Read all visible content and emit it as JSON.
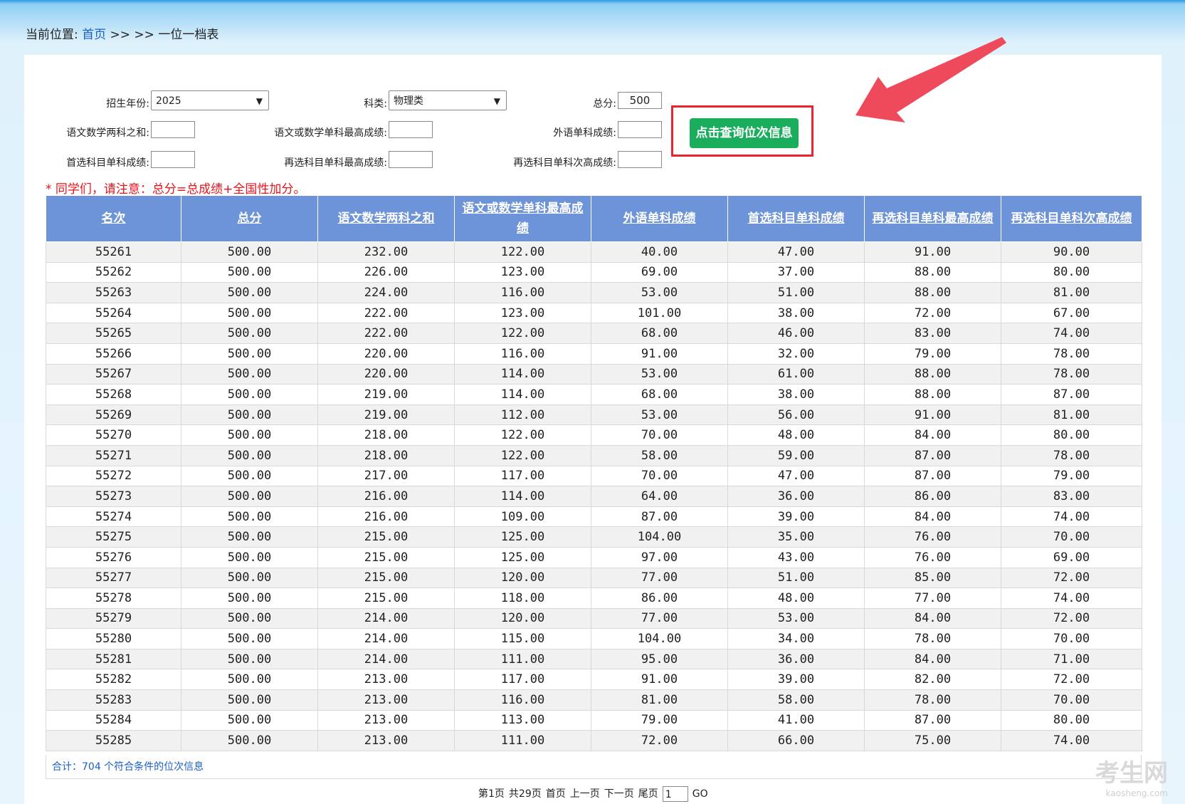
{
  "breadcrumb": {
    "label": "当前位置:",
    "home": "首页",
    "sep": " >> >> ",
    "current": "一位一档表"
  },
  "form": {
    "year_label": "招生年份:",
    "year_value": "2025",
    "type_label": "科类:",
    "type_value": "物理类",
    "total_label": "总分:",
    "total_value": "500",
    "cm_sum_label": "语文数学两科之和:",
    "cm_max_label": "语文或数学单科最高成绩:",
    "fl_label": "外语单科成绩:",
    "first_label": "首选科目单科成绩:",
    "re_max_label": "再选科目单科最高成绩:",
    "re_second_label": "再选科目单科次高成绩:",
    "query_button": "点击查询位次信息"
  },
  "notice": "* 同学们，请注意：总分=总成绩+全国性加分。",
  "table": {
    "headers": [
      "名次",
      "总分",
      "语文数学两科之和",
      "语文或数学单科最高成绩",
      "外语单科成绩",
      "首选科目单科成绩",
      "再选科目单科最高成绩",
      "再选科目单科次高成绩"
    ],
    "rows": [
      [
        "55261",
        "500.00",
        "232.00",
        "122.00",
        "40.00",
        "47.00",
        "91.00",
        "90.00"
      ],
      [
        "55262",
        "500.00",
        "226.00",
        "123.00",
        "69.00",
        "37.00",
        "88.00",
        "80.00"
      ],
      [
        "55263",
        "500.00",
        "224.00",
        "116.00",
        "53.00",
        "51.00",
        "88.00",
        "81.00"
      ],
      [
        "55264",
        "500.00",
        "222.00",
        "123.00",
        "101.00",
        "38.00",
        "72.00",
        "67.00"
      ],
      [
        "55265",
        "500.00",
        "222.00",
        "122.00",
        "68.00",
        "46.00",
        "83.00",
        "74.00"
      ],
      [
        "55266",
        "500.00",
        "220.00",
        "116.00",
        "91.00",
        "32.00",
        "79.00",
        "78.00"
      ],
      [
        "55267",
        "500.00",
        "220.00",
        "114.00",
        "53.00",
        "61.00",
        "88.00",
        "78.00"
      ],
      [
        "55268",
        "500.00",
        "219.00",
        "114.00",
        "68.00",
        "38.00",
        "88.00",
        "87.00"
      ],
      [
        "55269",
        "500.00",
        "219.00",
        "112.00",
        "53.00",
        "56.00",
        "91.00",
        "81.00"
      ],
      [
        "55270",
        "500.00",
        "218.00",
        "122.00",
        "70.00",
        "48.00",
        "84.00",
        "80.00"
      ],
      [
        "55271",
        "500.00",
        "218.00",
        "122.00",
        "58.00",
        "59.00",
        "87.00",
        "78.00"
      ],
      [
        "55272",
        "500.00",
        "217.00",
        "117.00",
        "70.00",
        "47.00",
        "87.00",
        "79.00"
      ],
      [
        "55273",
        "500.00",
        "216.00",
        "114.00",
        "64.00",
        "36.00",
        "86.00",
        "83.00"
      ],
      [
        "55274",
        "500.00",
        "216.00",
        "109.00",
        "87.00",
        "39.00",
        "84.00",
        "74.00"
      ],
      [
        "55275",
        "500.00",
        "215.00",
        "125.00",
        "104.00",
        "35.00",
        "76.00",
        "70.00"
      ],
      [
        "55276",
        "500.00",
        "215.00",
        "125.00",
        "97.00",
        "43.00",
        "76.00",
        "69.00"
      ],
      [
        "55277",
        "500.00",
        "215.00",
        "120.00",
        "77.00",
        "51.00",
        "85.00",
        "72.00"
      ],
      [
        "55278",
        "500.00",
        "215.00",
        "118.00",
        "86.00",
        "48.00",
        "77.00",
        "74.00"
      ],
      [
        "55279",
        "500.00",
        "214.00",
        "120.00",
        "77.00",
        "53.00",
        "84.00",
        "72.00"
      ],
      [
        "55280",
        "500.00",
        "214.00",
        "115.00",
        "104.00",
        "34.00",
        "78.00",
        "70.00"
      ],
      [
        "55281",
        "500.00",
        "214.00",
        "111.00",
        "95.00",
        "36.00",
        "84.00",
        "71.00"
      ],
      [
        "55282",
        "500.00",
        "213.00",
        "117.00",
        "91.00",
        "39.00",
        "82.00",
        "72.00"
      ],
      [
        "55283",
        "500.00",
        "213.00",
        "116.00",
        "81.00",
        "58.00",
        "78.00",
        "70.00"
      ],
      [
        "55284",
        "500.00",
        "213.00",
        "113.00",
        "79.00",
        "41.00",
        "87.00",
        "80.00"
      ],
      [
        "55285",
        "500.00",
        "213.00",
        "111.00",
        "72.00",
        "66.00",
        "75.00",
        "74.00"
      ]
    ]
  },
  "total_text": "合计：704 个符合条件的位次信息",
  "pager": {
    "current": "第1页",
    "count": "共29页",
    "first": "首页",
    "prev": "上一页",
    "next": "下一页",
    "last": "尾页",
    "page_input": "1",
    "go": "GO"
  },
  "watermark": {
    "brand": "考生网",
    "domain": "kaosheng.com"
  },
  "colors": {
    "header_bg": "#6d93d8",
    "button_bg": "#1aae5c",
    "notice": "#e8141c",
    "link": "#1a5fc8",
    "highlight": "#e8242c"
  },
  "icons": [
    "chevron-down-icon",
    "arrow-pointer-icon"
  ]
}
